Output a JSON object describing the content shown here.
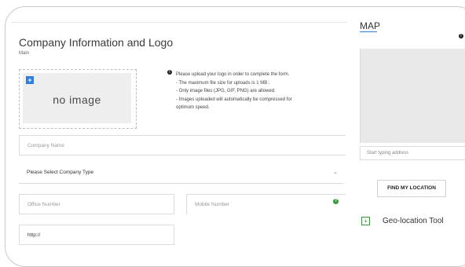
{
  "header": {
    "title": "Company Information and Logo",
    "subtitle": "Main"
  },
  "logo_upload": {
    "placeholder": "no image",
    "add_icon": "plus-icon"
  },
  "help": {
    "lines": [
      "Please upload your logo in order to complete the form.",
      "- The maximum file size for uploads is 1 MB .",
      "- Only image files (JPG, GIF, PNG) are allowed.",
      "- Images uploaded will automatically be compressed for",
      "optimum speed."
    ]
  },
  "form": {
    "company_name_placeholder": "Company Name",
    "company_type_label": "Please Select Company Type",
    "office_number_placeholder": "Office Number",
    "mobile_number_placeholder": "Mobile Number",
    "website_value": "http://"
  },
  "map": {
    "title": "MAP",
    "address_placeholder": "Start typing address",
    "find_button": "FIND MY LOCATION",
    "geo_tool_label": "Geo-location Tool"
  },
  "colors": {
    "accent_blue": "#2f7fd9",
    "accent_green": "#3b9a3b"
  }
}
